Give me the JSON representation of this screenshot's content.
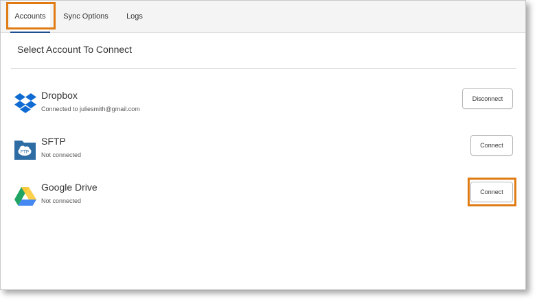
{
  "tabs": [
    {
      "label": "Accounts",
      "active": true
    },
    {
      "label": "Sync Options",
      "active": false
    },
    {
      "label": "Logs",
      "active": false
    }
  ],
  "section_title": "Select Account To Connect",
  "accounts": [
    {
      "name": "Dropbox",
      "status": "Connected to juliesmith@gmail.com",
      "button": "Disconnect",
      "icon": "dropbox-icon"
    },
    {
      "name": "SFTP",
      "status": "Not connected",
      "button": "Connect",
      "icon": "sftp-folder-icon",
      "icon_text": "FTP"
    },
    {
      "name": "Google Drive",
      "status": "Not connected",
      "button": "Connect",
      "icon": "google-drive-icon"
    }
  ],
  "colors": {
    "highlight": "#e07b14",
    "tab_underline": "#1d4e8f",
    "dropbox_blue": "#0f6bd1",
    "sftp_blue": "#2e6da4",
    "drive_green": "#1fa463",
    "drive_yellow": "#ffd04b",
    "drive_blue": "#4688f1"
  }
}
